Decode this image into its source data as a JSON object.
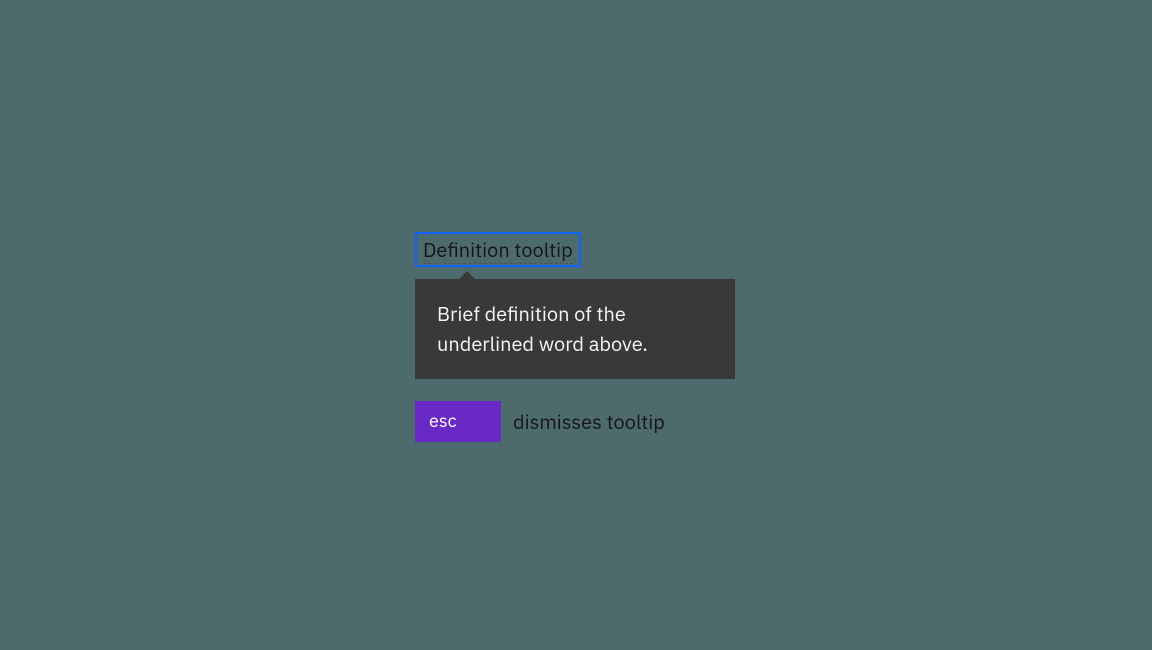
{
  "trigger": {
    "label": "Definition tooltip"
  },
  "tooltip": {
    "content": "Brief definition of the underlined word above."
  },
  "hint": {
    "key_label": "esc",
    "description": "dismisses tooltip"
  }
}
